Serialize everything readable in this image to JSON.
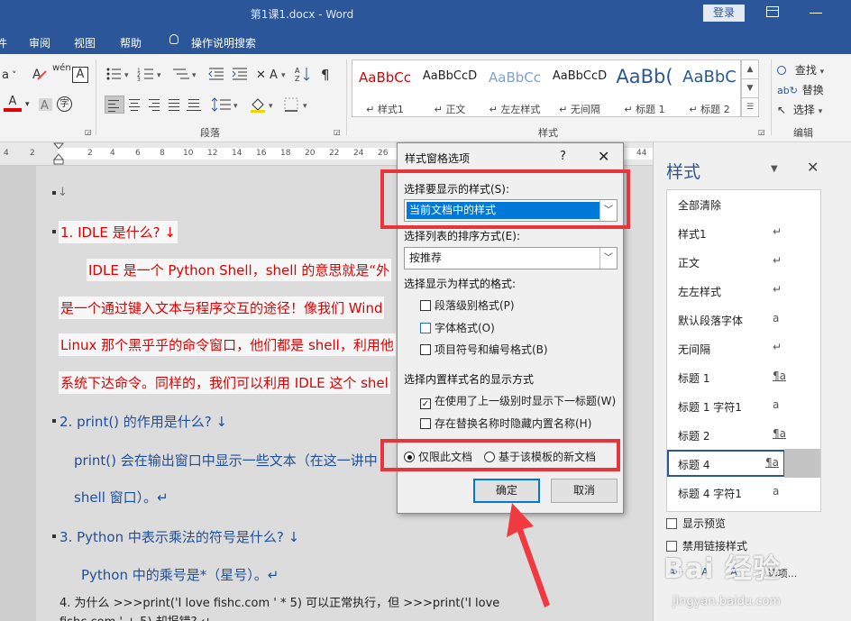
{
  "window": {
    "title": "第1课1.docx  -  Word",
    "login_label": "登录"
  },
  "menu": {
    "items": [
      "审阅",
      "视图",
      "帮助",
      "操作说明搜索"
    ]
  },
  "ribbon": {
    "group_paragraph": "段落",
    "group_styles": "样式",
    "group_edit": "编辑",
    "phonetic_glyph": "wén",
    "boxed_glyph": "A",
    "enclosed_glyph": "字",
    "font_color_glyph": "A",
    "find_label": "查找",
    "replace_label": "替换",
    "select_label": "选择",
    "gallery": [
      {
        "preview": "AaBbCc",
        "name": "样式1"
      },
      {
        "preview": "AaBbCcD",
        "name": "正文"
      },
      {
        "preview": "AaBbCc",
        "name": "左左样式"
      },
      {
        "preview": "AaBbCcD",
        "name": "无间隔"
      },
      {
        "preview": "AaBb(",
        "name": "标题 1"
      },
      {
        "preview": "AaBbC",
        "name": "标题 2"
      }
    ],
    "style_name_prefix": "↵",
    "colors": {
      "title_bar": "#2b579a",
      "accent_red": "#e00000",
      "highlight": "#e8353b"
    }
  },
  "ruler": {
    "ticks": [
      "4",
      "2",
      "2",
      "4",
      "6",
      "8",
      "10",
      "12",
      "14",
      "16",
      "18",
      "20",
      "22",
      "24",
      "26",
      "28",
      "44"
    ]
  },
  "document": {
    "lines": [
      "↓",
      "1. IDLE  是什么? ↓",
      "IDLE 是一个 Python Shell，shell 的意思就是“外",
      "是一个通过键入文本与程序交互的途径！像我们 Wind",
      "Linux 那个黑乎乎的命令窗口，他们都是 shell，利用他",
      "系统下达命令。同样的，我们可以利用 IDLE 这个 shel",
      "2. print()  的作用是什么? ↓",
      "print()  会在输出窗口中显示一些文本（在这一讲中",
      "shell 窗口）。↵",
      "3. Python  中表示乘法的符号是什么? ↓",
      "Python 中的乘号是*（星号）。↵",
      "4.  为什么  >>>print('I love fishc.com ' * 5)  可以正常执行，但  >>>print('I love",
      "fishc.com ' + 5)  却报错? ↵"
    ]
  },
  "dialog": {
    "title": "样式窗格选项",
    "help": "?",
    "close": "✕",
    "label_show": "选择要显示的样式(S):",
    "show_value": "当前文档中的样式",
    "label_sort": "选择列表的排序方式(E):",
    "sort_value": "按推荐",
    "label_format": "选择显示为样式的格式:",
    "checkbox_paragraph": "段落级别格式(P)",
    "checkbox_font": "字体格式(O)",
    "checkbox_bullets": "项目符号和编号格式(B)",
    "label_builtin": "选择内置样式名的显示方式",
    "checkbox_next_heading": "在使用了上一级别时显示下一标题(W)",
    "checkbox_hide_builtin": "存在替换名称时隐藏内置名称(H)",
    "check_mark": "✓",
    "radio_this_doc": "仅限此文档",
    "radio_template": "基于该模板的新文档",
    "ok_label": "确定",
    "cancel_label": "取消"
  },
  "styles_pane": {
    "title": "样式",
    "items": [
      {
        "name": "全部清除",
        "icon": ""
      },
      {
        "name": "样式1",
        "icon": "↵"
      },
      {
        "name": "正文",
        "icon": "↵"
      },
      {
        "name": "左左样式",
        "icon": "↵"
      },
      {
        "name": "默认段落字体",
        "icon": "a"
      },
      {
        "name": "无间隔",
        "icon": "↵"
      },
      {
        "name": "标题 1",
        "icon": "¶a"
      },
      {
        "name": "标题 1 字符1",
        "icon": "a"
      },
      {
        "name": "标题 2",
        "icon": "¶a"
      },
      {
        "name": "标题 4",
        "icon": "¶a"
      },
      {
        "name": "标题 4 字符1",
        "icon": "a"
      }
    ],
    "show_preview": "显示预览",
    "disable_linked": "禁用链接样式",
    "options_label": "选项...",
    "button_new": "A+",
    "button_inspect": "A",
    "button_manage": "A"
  },
  "watermark": {
    "logo": "Bai 经验",
    "url": "jingyan.baidu.com"
  }
}
